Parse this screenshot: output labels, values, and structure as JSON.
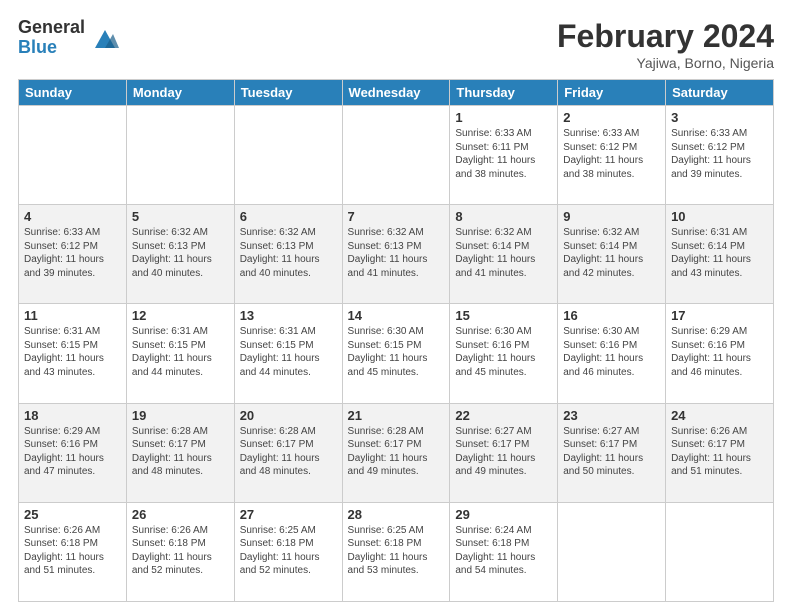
{
  "logo": {
    "general": "General",
    "blue": "Blue"
  },
  "title": {
    "month_year": "February 2024",
    "location": "Yajiwa, Borno, Nigeria"
  },
  "headers": [
    "Sunday",
    "Monday",
    "Tuesday",
    "Wednesday",
    "Thursday",
    "Friday",
    "Saturday"
  ],
  "weeks": [
    [
      {
        "day": null,
        "info": null
      },
      {
        "day": null,
        "info": null
      },
      {
        "day": null,
        "info": null
      },
      {
        "day": null,
        "info": null
      },
      {
        "day": "1",
        "info": "Sunrise: 6:33 AM\nSunset: 6:11 PM\nDaylight: 11 hours and 38 minutes."
      },
      {
        "day": "2",
        "info": "Sunrise: 6:33 AM\nSunset: 6:12 PM\nDaylight: 11 hours and 38 minutes."
      },
      {
        "day": "3",
        "info": "Sunrise: 6:33 AM\nSunset: 6:12 PM\nDaylight: 11 hours and 39 minutes."
      }
    ],
    [
      {
        "day": "4",
        "info": "Sunrise: 6:33 AM\nSunset: 6:12 PM\nDaylight: 11 hours and 39 minutes."
      },
      {
        "day": "5",
        "info": "Sunrise: 6:32 AM\nSunset: 6:13 PM\nDaylight: 11 hours and 40 minutes."
      },
      {
        "day": "6",
        "info": "Sunrise: 6:32 AM\nSunset: 6:13 PM\nDaylight: 11 hours and 40 minutes."
      },
      {
        "day": "7",
        "info": "Sunrise: 6:32 AM\nSunset: 6:13 PM\nDaylight: 11 hours and 41 minutes."
      },
      {
        "day": "8",
        "info": "Sunrise: 6:32 AM\nSunset: 6:14 PM\nDaylight: 11 hours and 41 minutes."
      },
      {
        "day": "9",
        "info": "Sunrise: 6:32 AM\nSunset: 6:14 PM\nDaylight: 11 hours and 42 minutes."
      },
      {
        "day": "10",
        "info": "Sunrise: 6:31 AM\nSunset: 6:14 PM\nDaylight: 11 hours and 43 minutes."
      }
    ],
    [
      {
        "day": "11",
        "info": "Sunrise: 6:31 AM\nSunset: 6:15 PM\nDaylight: 11 hours and 43 minutes."
      },
      {
        "day": "12",
        "info": "Sunrise: 6:31 AM\nSunset: 6:15 PM\nDaylight: 11 hours and 44 minutes."
      },
      {
        "day": "13",
        "info": "Sunrise: 6:31 AM\nSunset: 6:15 PM\nDaylight: 11 hours and 44 minutes."
      },
      {
        "day": "14",
        "info": "Sunrise: 6:30 AM\nSunset: 6:15 PM\nDaylight: 11 hours and 45 minutes."
      },
      {
        "day": "15",
        "info": "Sunrise: 6:30 AM\nSunset: 6:16 PM\nDaylight: 11 hours and 45 minutes."
      },
      {
        "day": "16",
        "info": "Sunrise: 6:30 AM\nSunset: 6:16 PM\nDaylight: 11 hours and 46 minutes."
      },
      {
        "day": "17",
        "info": "Sunrise: 6:29 AM\nSunset: 6:16 PM\nDaylight: 11 hours and 46 minutes."
      }
    ],
    [
      {
        "day": "18",
        "info": "Sunrise: 6:29 AM\nSunset: 6:16 PM\nDaylight: 11 hours and 47 minutes."
      },
      {
        "day": "19",
        "info": "Sunrise: 6:28 AM\nSunset: 6:17 PM\nDaylight: 11 hours and 48 minutes."
      },
      {
        "day": "20",
        "info": "Sunrise: 6:28 AM\nSunset: 6:17 PM\nDaylight: 11 hours and 48 minutes."
      },
      {
        "day": "21",
        "info": "Sunrise: 6:28 AM\nSunset: 6:17 PM\nDaylight: 11 hours and 49 minutes."
      },
      {
        "day": "22",
        "info": "Sunrise: 6:27 AM\nSunset: 6:17 PM\nDaylight: 11 hours and 49 minutes."
      },
      {
        "day": "23",
        "info": "Sunrise: 6:27 AM\nSunset: 6:17 PM\nDaylight: 11 hours and 50 minutes."
      },
      {
        "day": "24",
        "info": "Sunrise: 6:26 AM\nSunset: 6:17 PM\nDaylight: 11 hours and 51 minutes."
      }
    ],
    [
      {
        "day": "25",
        "info": "Sunrise: 6:26 AM\nSunset: 6:18 PM\nDaylight: 11 hours and 51 minutes."
      },
      {
        "day": "26",
        "info": "Sunrise: 6:26 AM\nSunset: 6:18 PM\nDaylight: 11 hours and 52 minutes."
      },
      {
        "day": "27",
        "info": "Sunrise: 6:25 AM\nSunset: 6:18 PM\nDaylight: 11 hours and 52 minutes."
      },
      {
        "day": "28",
        "info": "Sunrise: 6:25 AM\nSunset: 6:18 PM\nDaylight: 11 hours and 53 minutes."
      },
      {
        "day": "29",
        "info": "Sunrise: 6:24 AM\nSunset: 6:18 PM\nDaylight: 11 hours and 54 minutes."
      },
      {
        "day": null,
        "info": null
      },
      {
        "day": null,
        "info": null
      }
    ]
  ]
}
